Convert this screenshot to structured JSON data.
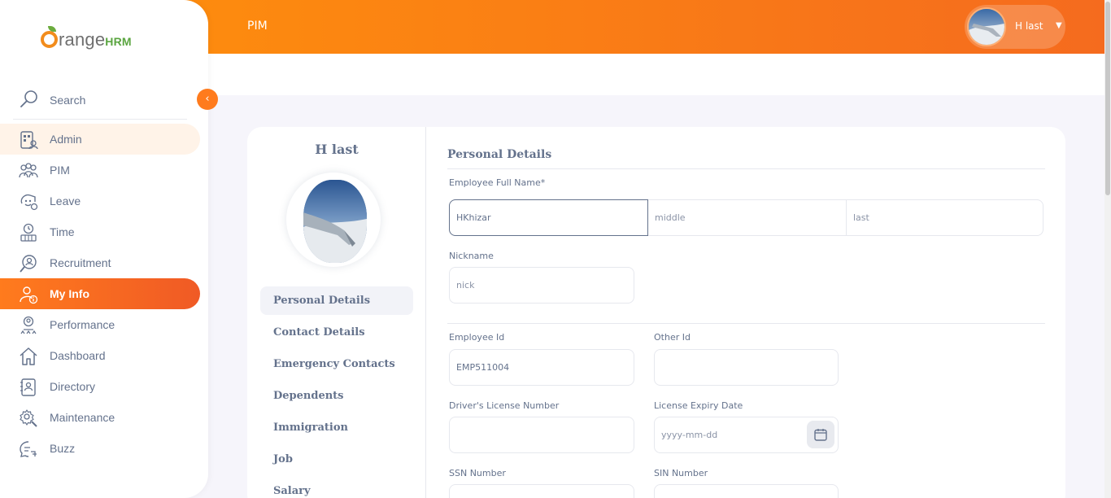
{
  "topbar": {
    "title": "PIM",
    "user_name": "H last",
    "caret_icon": "caret-down-icon"
  },
  "brand": {
    "logo_text": "range",
    "logo_suffix": "HRM",
    "accent": "#ff7b1d",
    "green": "#5aa540"
  },
  "sidebar": {
    "search_label": "Search",
    "items": [
      {
        "label": "Admin",
        "icon": "admin-icon"
      },
      {
        "label": "PIM",
        "icon": "pim-icon"
      },
      {
        "label": "Leave",
        "icon": "leave-icon"
      },
      {
        "label": "Time",
        "icon": "time-icon"
      },
      {
        "label": "Recruitment",
        "icon": "recruitment-icon"
      },
      {
        "label": "My Info",
        "icon": "my-info-icon"
      },
      {
        "label": "Performance",
        "icon": "performance-icon"
      },
      {
        "label": "Dashboard",
        "icon": "dashboard-icon"
      },
      {
        "label": "Directory",
        "icon": "directory-icon"
      },
      {
        "label": "Maintenance",
        "icon": "maintenance-icon"
      },
      {
        "label": "Buzz",
        "icon": "buzz-icon"
      }
    ],
    "active_item": "My Info",
    "hover_item": "Admin",
    "collapse_glyph": "‹"
  },
  "profile": {
    "name": "H last",
    "tabs": [
      {
        "label": "Personal Details"
      },
      {
        "label": "Contact Details"
      },
      {
        "label": "Emergency Contacts"
      },
      {
        "label": "Dependents"
      },
      {
        "label": "Immigration"
      },
      {
        "label": "Job"
      },
      {
        "label": "Salary"
      }
    ],
    "active_tab": "Personal Details"
  },
  "form": {
    "section_title": "Personal Details",
    "full_name_label": "Employee Full Name*",
    "first_name_value": "HKhizar",
    "middle_name_placeholder": "middle",
    "last_name_placeholder": "last",
    "nickname_label": "Nickname",
    "nickname_placeholder": "nick",
    "employee_id_label": "Employee Id",
    "employee_id_value": "EMP511004",
    "other_id_label": "Other Id",
    "other_id_value": "",
    "license_label": "Driver's License Number",
    "license_value": "",
    "license_expiry_label": "License Expiry Date",
    "license_expiry_placeholder": "yyyy-mm-dd",
    "ssn_label": "SSN Number",
    "sin_label": "SIN Number"
  }
}
